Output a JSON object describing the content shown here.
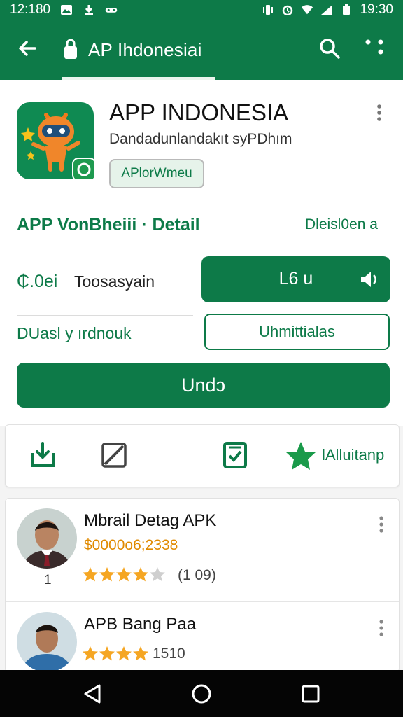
{
  "status_bar": {
    "time_left": "12:180",
    "time_right": "19:30",
    "icons_left": [
      "gallery-icon",
      "download-icon",
      "voicemail-icon"
    ],
    "icons_right": [
      "vibrate-icon",
      "alarm-icon",
      "wifi-icon",
      "signal-icon",
      "battery-icon"
    ]
  },
  "app_bar": {
    "title": "AP Ihdonesiai",
    "icons": [
      "back-arrow-icon",
      "lock-icon",
      "search-icon",
      "more-icon"
    ]
  },
  "app_header": {
    "name": "APP INDONESIA",
    "subtitle": "Dandadunlandakıt syPDhım",
    "chip": "APlorWmeu"
  },
  "detail": {
    "title": "APP VonBheiii · Detail",
    "right_label": "Dleisl0en a",
    "price": "₵.0ei",
    "price_note": "Toosasyain",
    "primary_button": "L6 u",
    "developer": "DUasl y ırdnouk",
    "outline_button": "Uhmittialas",
    "main_button": "Undɔ"
  },
  "actions": {
    "items": [
      "download-icon",
      "expand-icon",
      "checklist-icon",
      "star-icon"
    ],
    "label": "lAlluitanp"
  },
  "list": [
    {
      "title": "Mbrail Detag APK",
      "price": "$0000o6;2338",
      "rating": 4,
      "count": "(1 09)",
      "rank": "1"
    },
    {
      "title": "APB Bang Paa",
      "rating": 4,
      "count": "1510"
    }
  ],
  "colors": {
    "primary": "#0d7a48",
    "star": "#f5a623",
    "price": "#e08a00"
  },
  "nav_bar": [
    "back-triangle-icon",
    "home-circle-icon",
    "recents-square-icon"
  ]
}
